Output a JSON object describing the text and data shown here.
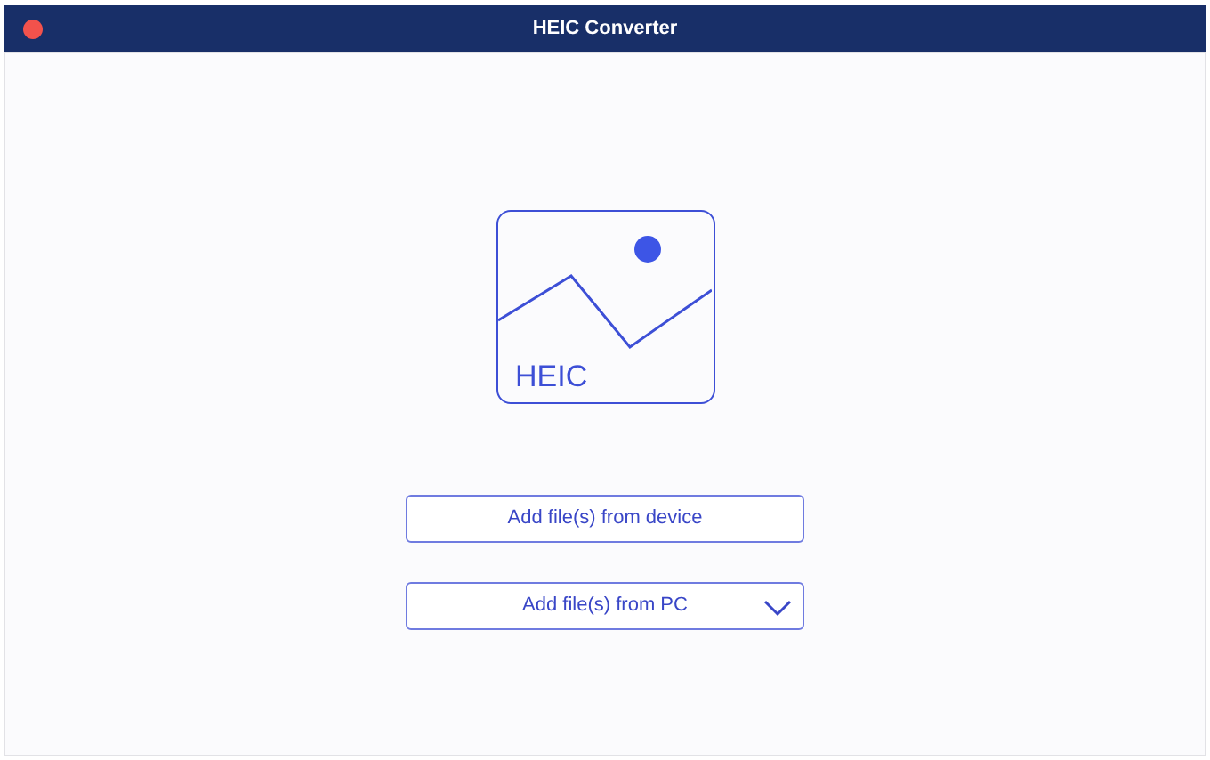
{
  "window": {
    "title": "HEIC Converter"
  },
  "preview": {
    "label": "HEIC"
  },
  "buttons": [
    {
      "label": "Add file(s) from device",
      "kind": "plain"
    },
    {
      "label": "Add file(s) from PC",
      "kind": "dropdown"
    }
  ]
}
